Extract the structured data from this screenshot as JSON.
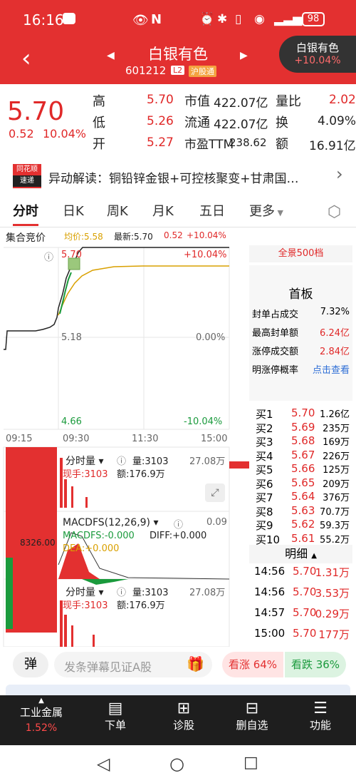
{
  "status": {
    "time": "16:16",
    "battery": "98"
  },
  "header": {
    "title": "白银有色",
    "code": "601212",
    "l2": "L2",
    "market": "沪股通",
    "mini_name": "白银有色",
    "mini_change": "+10.04%"
  },
  "quote": {
    "price": "5.70",
    "change": "0.52",
    "pct": "10.04%",
    "high_label": "高",
    "high": "5.70",
    "low_label": "低",
    "low": "5.26",
    "open_label": "开",
    "open": "5.27",
    "mcap_label": "市值",
    "mcap": "422.07亿",
    "float_label": "流通",
    "float": "422.07亿",
    "pe_label": "市盈TTM",
    "pe": "238.62",
    "ratio_label": "量比",
    "ratio": "2.02",
    "turn_label": "换",
    "turn": "4.09%",
    "amt_label": "额",
    "amt": "16.91亿"
  },
  "news": {
    "logo_top": "同花顺",
    "logo_bottom": "速递",
    "text": "异动解读：铜铅锌金银+可控核聚变+甘肃国…"
  },
  "tabs": [
    "分时",
    "日K",
    "周K",
    "月K",
    "五日",
    "更多"
  ],
  "chart": {
    "auction_label": "集合竞价",
    "avg_label": "均价:5.58",
    "latest_label": "最新:5.70",
    "chg": "0.52",
    "chg_pct": "+10.04%",
    "ax_top": "5.70",
    "ax_mid": "5.18",
    "ax_bot": "4.66",
    "pct_top": "+10.04%",
    "pct_mid": "0.00%",
    "pct_bot": "-10.04%",
    "time_0915": "09:15",
    "time_0930": "09:30",
    "time_1130": "11:30",
    "time_1500": "15:00",
    "auction_vol": "8326.00",
    "vol1": {
      "label": "分时量",
      "vol": "量:3103",
      "max": "27.08万",
      "hand": "现手:3103",
      "amt": "额:176.9万"
    },
    "macd": {
      "label": "MACDFS(12,26,9)",
      "max": "0.09",
      "macd": "MACDFS:-0.000",
      "diff": "DIFF:+0.000",
      "dea": "DEA:+0.000"
    },
    "vol2": {
      "label": "分时量",
      "vol": "量:3103",
      "max": "27.08万",
      "hand": "现手:3103",
      "amt": "额:176.9万"
    }
  },
  "panel": {
    "full": "全景500档",
    "title": "首板",
    "r1l": "封单占成交",
    "r1v": "7.32%",
    "r2l": "最高封单额",
    "r2v": "6.24亿",
    "r3l": "涨停成交额",
    "r3v": "2.84亿",
    "r4l": "明涨停概率",
    "r4v": "点击查看"
  },
  "orderbook": [
    {
      "l": "买1",
      "p": "5.70",
      "v": "1.26亿"
    },
    {
      "l": "买2",
      "p": "5.69",
      "v": "235万"
    },
    {
      "l": "买3",
      "p": "5.68",
      "v": "169万"
    },
    {
      "l": "买4",
      "p": "5.67",
      "v": "226万"
    },
    {
      "l": "买5",
      "p": "5.66",
      "v": "125万"
    },
    {
      "l": "买6",
      "p": "5.65",
      "v": "209万"
    },
    {
      "l": "买7",
      "p": "5.64",
      "v": "376万"
    },
    {
      "l": "买8",
      "p": "5.63",
      "v": "70.7万"
    },
    {
      "l": "买9",
      "p": "5.62",
      "v": "59.3万"
    },
    {
      "l": "买10",
      "p": "5.61",
      "v": "55.2万"
    }
  ],
  "detail": {
    "title": "明细",
    "rows": [
      {
        "t": "14:56",
        "p": "5.70",
        "v": "1.31万"
      },
      {
        "t": "14:56",
        "p": "5.70",
        "v": "3.53万"
      },
      {
        "t": "14:57",
        "p": "5.70",
        "v": "0.29万"
      },
      {
        "t": "15:00",
        "p": "5.70",
        "v": "177万"
      }
    ]
  },
  "danmu": {
    "icon": "弹",
    "placeholder": "发条弹幕见证A股",
    "up": "看涨 64%",
    "down": "看跌 36%"
  },
  "bottom": {
    "industry": "工业金属",
    "industry_pct": "1.52%",
    "order": "下单",
    "diag": "诊股",
    "remove": "删自选",
    "func": "功能"
  }
}
